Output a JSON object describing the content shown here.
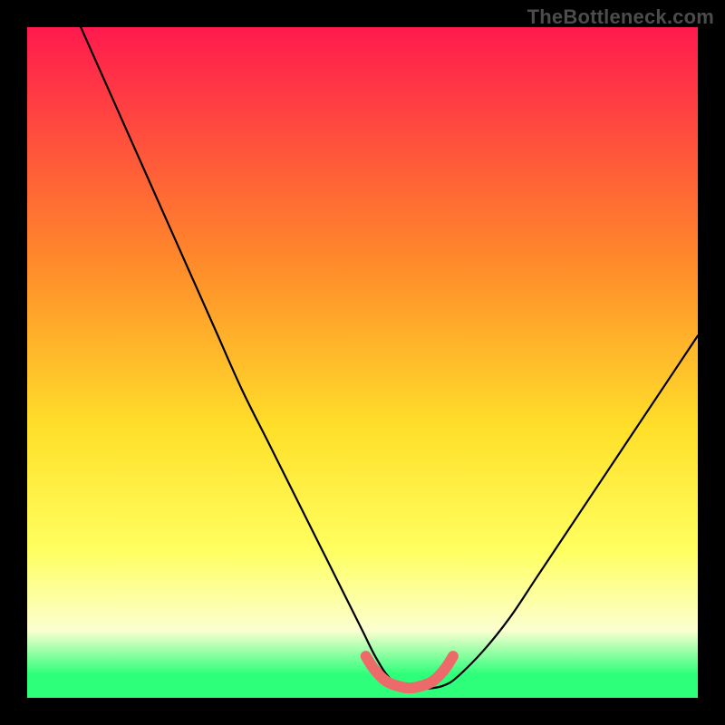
{
  "watermark": {
    "text": "TheBottleneck.com"
  },
  "colors": {
    "black": "#000000",
    "grad_top": "#ff1a4e",
    "grad_mid1": "#ff8a2a",
    "grad_mid2": "#ffe02a",
    "grad_mid3": "#ffff60",
    "grad_low": "#fbffd0",
    "grad_green": "#2dff7a",
    "curve": "#000000",
    "coral": "#ec6a6a"
  },
  "chart_data": {
    "type": "line",
    "title": "",
    "xlabel": "",
    "ylabel": "",
    "xlim": [
      0,
      100
    ],
    "ylim": [
      0,
      100
    ],
    "gradient_stops": [
      {
        "offset": 0.0,
        "color": "#ff1a4e"
      },
      {
        "offset": 0.35,
        "color": "#ff8a2a"
      },
      {
        "offset": 0.6,
        "color": "#ffe02a"
      },
      {
        "offset": 0.78,
        "color": "#ffff60"
      },
      {
        "offset": 0.9,
        "color": "#fbffd0"
      },
      {
        "offset": 0.965,
        "color": "#2dff7a"
      },
      {
        "offset": 1.0,
        "color": "#2dff7a"
      }
    ],
    "series": [
      {
        "name": "bottleneck-curve",
        "x": [
          8,
          12,
          16,
          20,
          24,
          28,
          32,
          36,
          40,
          44,
          48,
          50,
          52,
          54,
          56,
          58,
          60,
          62,
          64,
          68,
          72,
          76,
          80,
          84,
          88,
          92,
          96,
          100
        ],
        "y": [
          100,
          91,
          82,
          73,
          64,
          55,
          46,
          38,
          30,
          22,
          14,
          10,
          6,
          3,
          1.8,
          1.4,
          1.4,
          1.8,
          3,
          7,
          12,
          18,
          24,
          30,
          36,
          42,
          48,
          54
        ]
      }
    ],
    "highlight": {
      "name": "optimal-range",
      "x": [
        50.5,
        51.5,
        52.5,
        53.5,
        54.5,
        55.5,
        56.5,
        57.5,
        58.5,
        59.5,
        60.5,
        61.5,
        62.5,
        63.5
      ],
      "y": [
        6.2,
        4.6,
        3.4,
        2.5,
        2.0,
        1.7,
        1.5,
        1.5,
        1.7,
        2.0,
        2.5,
        3.4,
        4.6,
        6.2
      ]
    }
  }
}
